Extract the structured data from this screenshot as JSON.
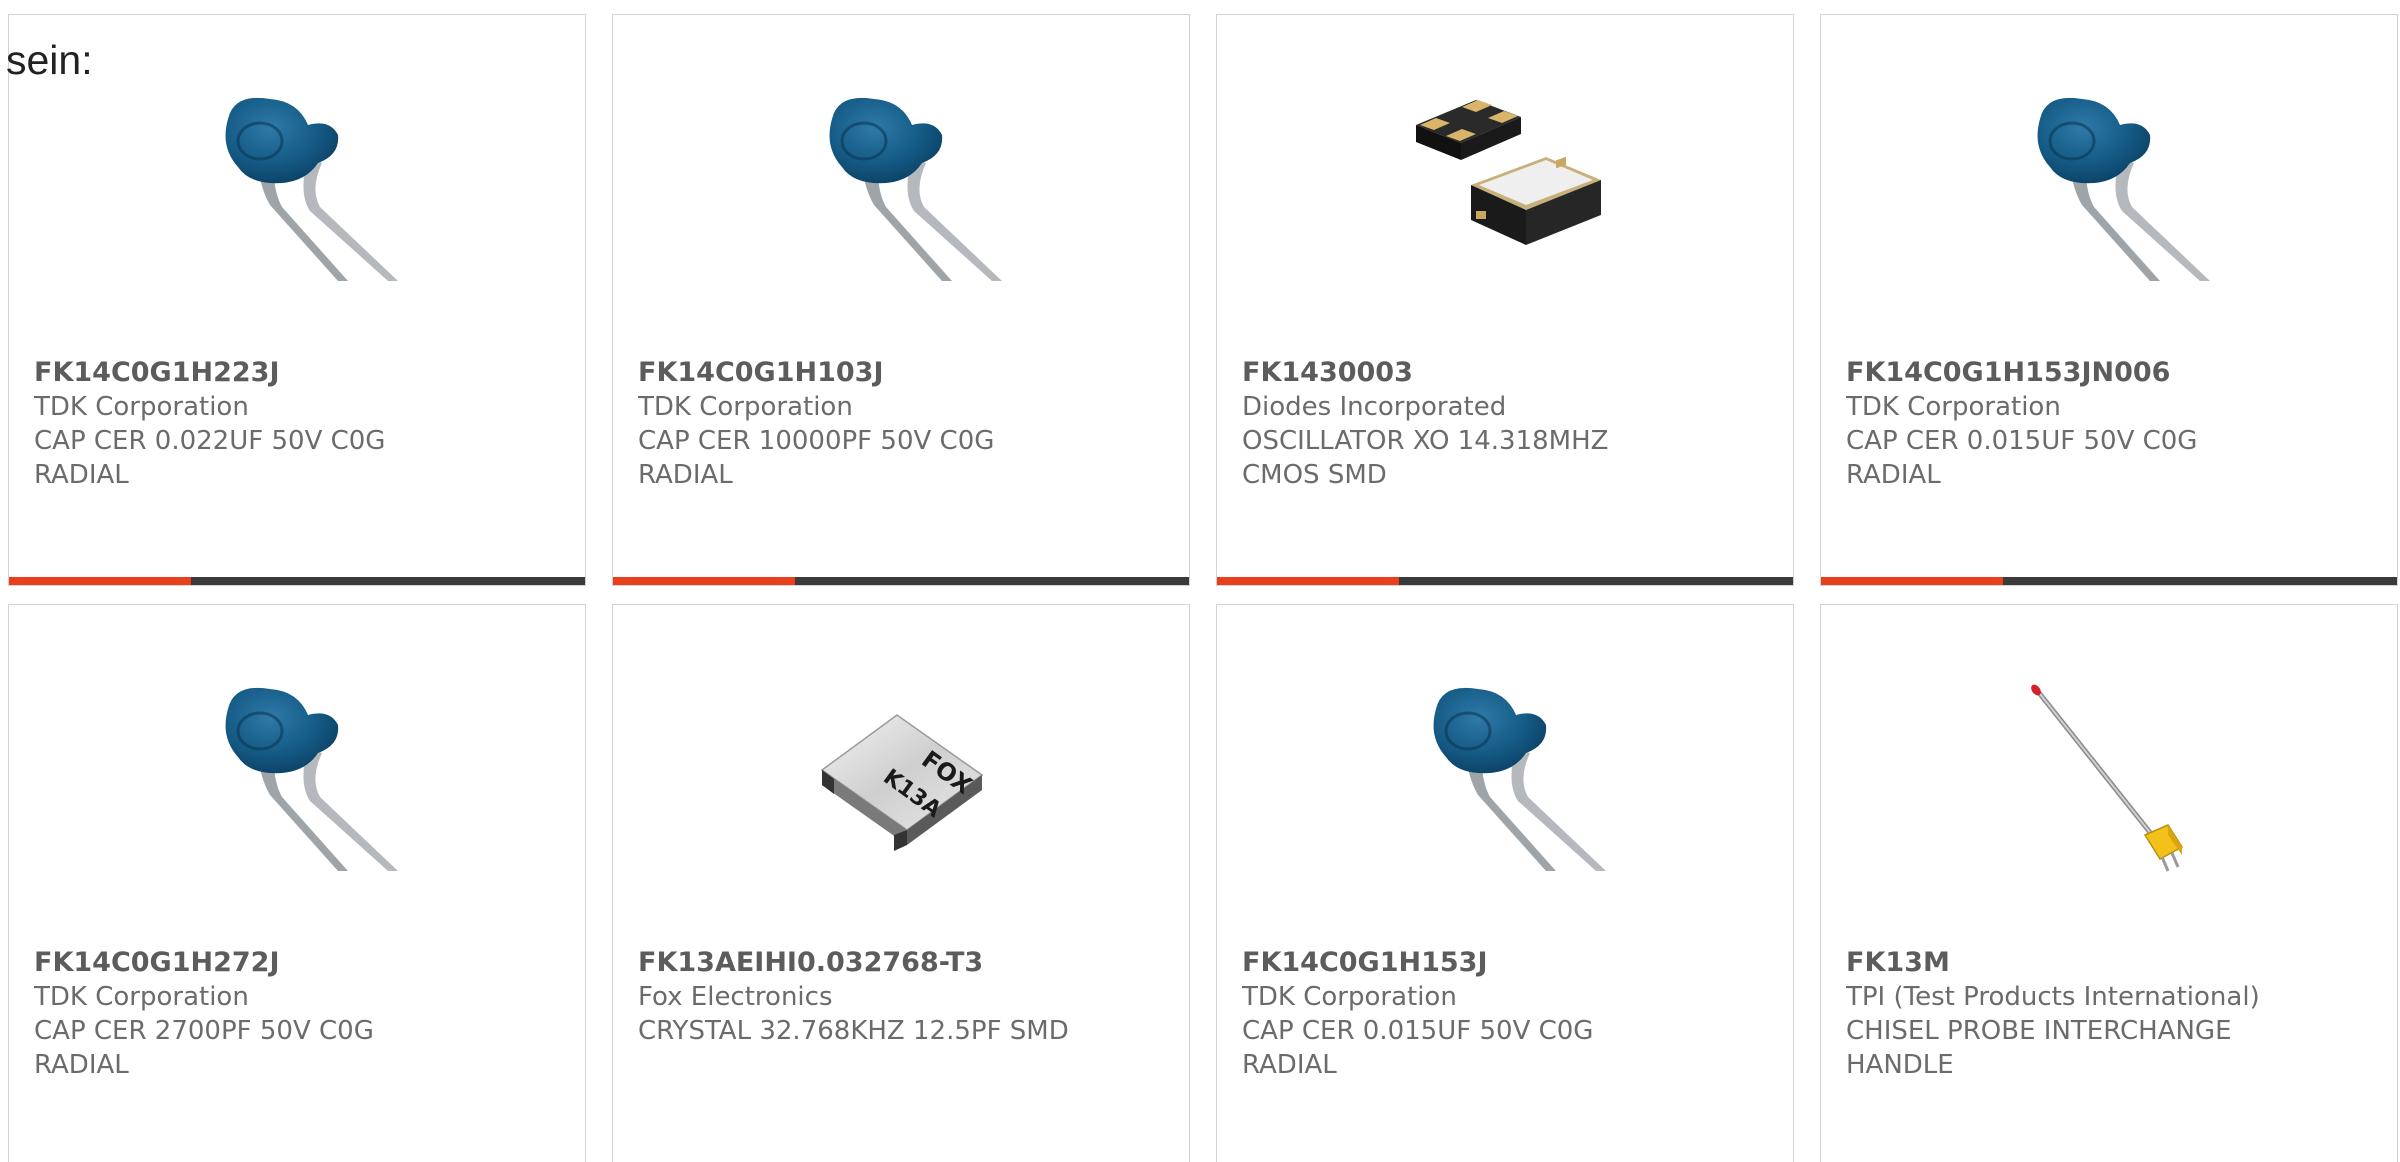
{
  "intro_text": "sein:",
  "accent_color": "#e8401c",
  "bar_color": "#3a3a3a",
  "products": [
    {
      "part": "FK14C0G1H223J",
      "manufacturer": "TDK Corporation",
      "desc1": "CAP CER 0.022UF 50V C0G",
      "desc2": "RADIAL",
      "image": "radial-capacitor-image"
    },
    {
      "part": "FK14C0G1H103J",
      "manufacturer": "TDK Corporation",
      "desc1": "CAP CER 10000PF 50V C0G",
      "desc2": "RADIAL",
      "image": "radial-capacitor-image"
    },
    {
      "part": "FK1430003",
      "manufacturer": "Diodes Incorporated",
      "desc1": "OSCILLATOR XO 14.318MHZ",
      "desc2": "CMOS SMD",
      "image": "smd-oscillator-image"
    },
    {
      "part": "FK14C0G1H153JN006",
      "manufacturer": "TDK Corporation",
      "desc1": "CAP CER 0.015UF 50V C0G",
      "desc2": "RADIAL",
      "image": "radial-capacitor-image"
    },
    {
      "part": "FK14C0G1H272J",
      "manufacturer": "TDK Corporation",
      "desc1": "CAP CER 2700PF 50V C0G",
      "desc2": "RADIAL",
      "image": "radial-capacitor-image"
    },
    {
      "part": "FK13AEIHI0.032768-T3",
      "manufacturer": "Fox Electronics",
      "desc1": "CRYSTAL 32.768KHZ 12.5PF SMD",
      "desc2": "",
      "image": "smd-crystal-image",
      "marking1": "FOX",
      "marking2": "K13A"
    },
    {
      "part": "FK14C0G1H153J",
      "manufacturer": "TDK Corporation",
      "desc1": "CAP CER 0.015UF 50V C0G",
      "desc2": "RADIAL",
      "image": "radial-capacitor-image"
    },
    {
      "part": "FK13M",
      "manufacturer": "TPI (Test Products International)",
      "desc1": "CHISEL PROBE INTERCHANGE",
      "desc2": "HANDLE",
      "image": "temperature-probe-image"
    }
  ]
}
